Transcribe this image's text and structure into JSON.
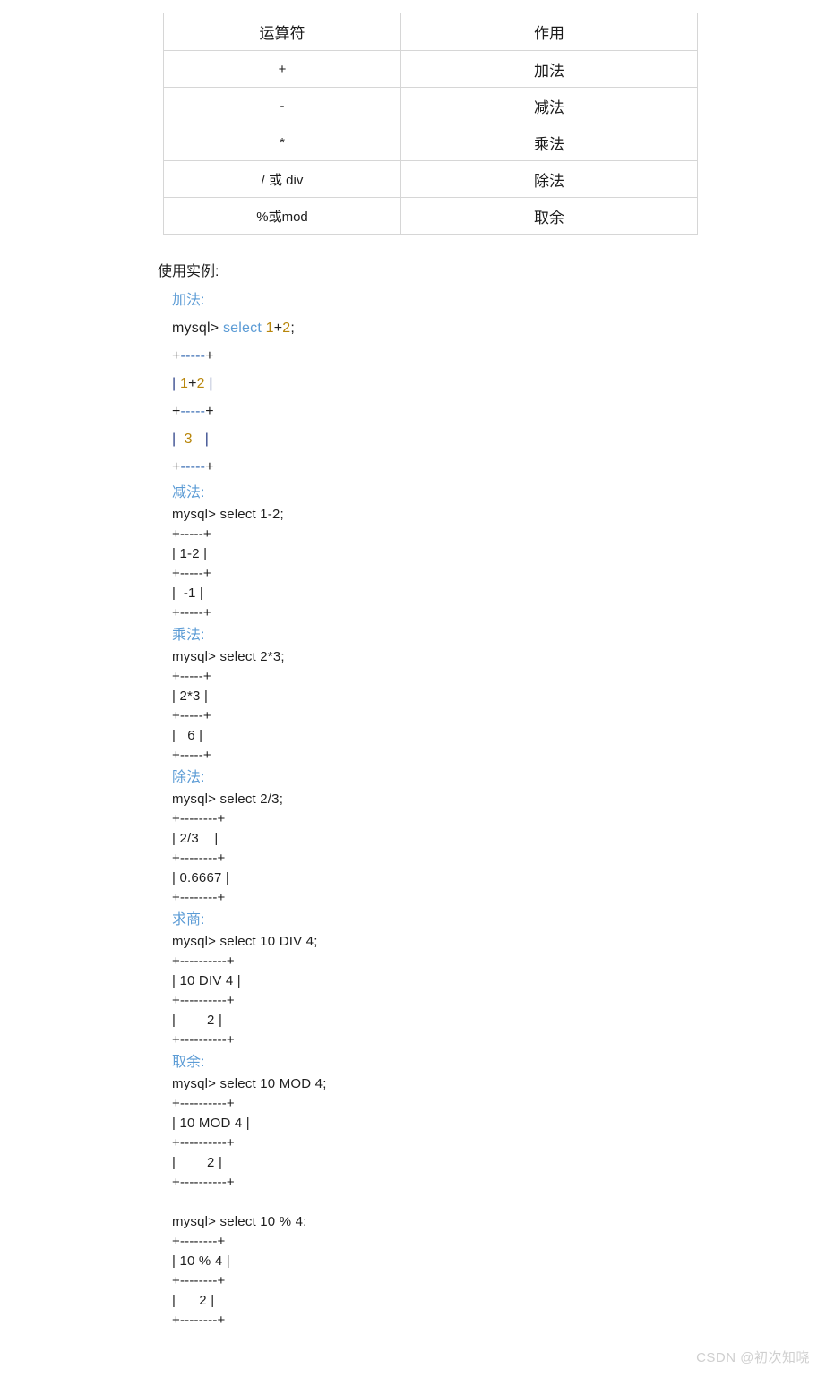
{
  "table": {
    "headers": [
      "运算符",
      "作用"
    ],
    "rows": [
      {
        "operator": "+",
        "effect": "加法"
      },
      {
        "operator": "-",
        "effect": "减法"
      },
      {
        "operator": "*",
        "effect": "乘法"
      },
      {
        "operator": "/ 或 div",
        "effect": "除法"
      },
      {
        "operator": "%或mod",
        "effect": "取余"
      }
    ]
  },
  "examples": {
    "title": "使用实例:",
    "blocks": [
      {
        "heading": "加法:",
        "highlighted": true,
        "lines": [
          [
            {
              "t": "mysql> ",
              "c": "prompt"
            },
            {
              "t": "select ",
              "c": "kw"
            },
            {
              "t": "1",
              "c": "num"
            },
            {
              "t": "+",
              "c": "plus"
            },
            {
              "t": "2",
              "c": "num"
            },
            {
              "t": ";",
              "c": "prompt"
            }
          ],
          [
            {
              "t": "+",
              "c": "plus"
            },
            {
              "t": "-----",
              "c": "dash"
            },
            {
              "t": "+",
              "c": "plus"
            }
          ],
          [
            {
              "t": "| ",
              "c": "pipe"
            },
            {
              "t": "1",
              "c": "num"
            },
            {
              "t": "+",
              "c": "plus"
            },
            {
              "t": "2",
              "c": "num"
            },
            {
              "t": " |",
              "c": "pipe"
            }
          ],
          [
            {
              "t": "+",
              "c": "plus"
            },
            {
              "t": "-----",
              "c": "dash"
            },
            {
              "t": "+",
              "c": "plus"
            }
          ],
          [
            {
              "t": "|  ",
              "c": "pipe"
            },
            {
              "t": "3",
              "c": "num"
            },
            {
              "t": "   |",
              "c": "pipe"
            }
          ],
          [
            {
              "t": "+",
              "c": "plus"
            },
            {
              "t": "-----",
              "c": "dash"
            },
            {
              "t": "+",
              "c": "plus"
            }
          ]
        ]
      },
      {
        "heading": "减法:",
        "highlighted": false,
        "lines": [
          [
            {
              "t": "mysql> select 1-2;",
              "c": "plain"
            }
          ],
          [
            {
              "t": "+-----+",
              "c": "plain"
            }
          ],
          [
            {
              "t": "| 1-2 |",
              "c": "plain"
            }
          ],
          [
            {
              "t": "+-----+",
              "c": "plain"
            }
          ],
          [
            {
              "t": "|  -1 |",
              "c": "plain"
            }
          ],
          [
            {
              "t": "+-----+",
              "c": "plain"
            }
          ]
        ]
      },
      {
        "heading": "乘法:",
        "highlighted": false,
        "lines": [
          [
            {
              "t": "mysql> select 2*3;",
              "c": "plain"
            }
          ],
          [
            {
              "t": "+-----+",
              "c": "plain"
            }
          ],
          [
            {
              "t": "| 2*3 |",
              "c": "plain"
            }
          ],
          [
            {
              "t": "+-----+",
              "c": "plain"
            }
          ],
          [
            {
              "t": "|   6 |",
              "c": "plain"
            }
          ],
          [
            {
              "t": "+-----+",
              "c": "plain"
            }
          ]
        ]
      },
      {
        "heading": "除法:",
        "highlighted": false,
        "lines": [
          [
            {
              "t": "mysql> select 2/3;",
              "c": "plain"
            }
          ],
          [
            {
              "t": "+--------+",
              "c": "plain"
            }
          ],
          [
            {
              "t": "| 2/3    |",
              "c": "plain"
            }
          ],
          [
            {
              "t": "+--------+",
              "c": "plain"
            }
          ],
          [
            {
              "t": "| 0.6667 |",
              "c": "plain"
            }
          ],
          [
            {
              "t": "+--------+",
              "c": "plain"
            }
          ]
        ]
      },
      {
        "heading": "求商:",
        "highlighted": false,
        "lines": [
          [
            {
              "t": "mysql> select 10 DIV 4;",
              "c": "plain"
            }
          ],
          [
            {
              "t": "+----------+",
              "c": "plain"
            }
          ],
          [
            {
              "t": "| 10 DIV 4 |",
              "c": "plain"
            }
          ],
          [
            {
              "t": "+----------+",
              "c": "plain"
            }
          ],
          [
            {
              "t": "|        2 |",
              "c": "plain"
            }
          ],
          [
            {
              "t": "+----------+",
              "c": "plain"
            }
          ]
        ]
      },
      {
        "heading": "取余:",
        "highlighted": false,
        "lines": [
          [
            {
              "t": "mysql> select 10 MOD 4;",
              "c": "plain"
            }
          ],
          [
            {
              "t": "+----------+",
              "c": "plain"
            }
          ],
          [
            {
              "t": "| 10 MOD 4 |",
              "c": "plain"
            }
          ],
          [
            {
              "t": "+----------+",
              "c": "plain"
            }
          ],
          [
            {
              "t": "|        2 |",
              "c": "plain"
            }
          ],
          [
            {
              "t": "+----------+",
              "c": "plain"
            }
          ],
          [
            {
              "t": "",
              "c": "plain"
            }
          ],
          [
            {
              "t": "mysql> select 10 % 4;",
              "c": "plain"
            }
          ],
          [
            {
              "t": "+--------+",
              "c": "plain"
            }
          ],
          [
            {
              "t": "| 10 % 4 |",
              "c": "plain"
            }
          ],
          [
            {
              "t": "+--------+",
              "c": "plain"
            }
          ],
          [
            {
              "t": "|      2 |",
              "c": "plain"
            }
          ],
          [
            {
              "t": "+--------+",
              "c": "plain"
            }
          ]
        ]
      }
    ]
  },
  "watermark": "CSDN @初次知晓"
}
